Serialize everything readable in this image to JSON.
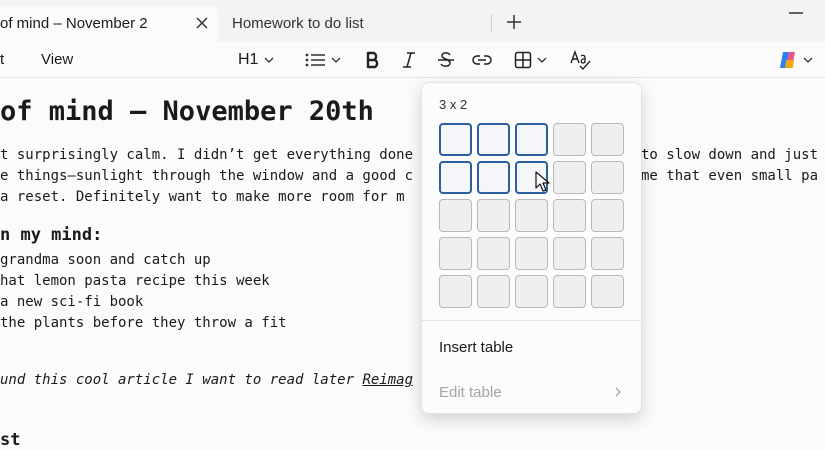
{
  "tabs": [
    {
      "title": "of mind – November 2",
      "active": true
    },
    {
      "title": "Homework to do list",
      "active": false
    }
  ],
  "menu": {
    "edit": "t",
    "view": "View"
  },
  "toolbar": {
    "heading": "H1"
  },
  "editor": {
    "title": "of mind – November 20th",
    "para1": "t surprisingly calm. I didn’t get everything done",
    "para1_tail": "to slow down and just",
    "para2": "e things—sunlight through the window and a good c",
    "para2_tail": "me that even small pa",
    "para3": "a reset. Definitely want to make more room for m",
    "section1": "n my mind:",
    "items": [
      "grandma soon and catch up",
      "hat lemon pasta recipe this week",
      "a new sci-fi book",
      " the plants before they throw a fit"
    ],
    "note": "und this cool article I want to read later ",
    "note_link": "Reimag",
    "section2": "st"
  },
  "table_popup": {
    "size_label": "3 x 2",
    "rows": 5,
    "cols": 5,
    "selected_cols": 3,
    "selected_rows": 2,
    "insert_label": "Insert table",
    "edit_label": "Edit table"
  },
  "colors": {
    "selection": "#2b5f9e",
    "copilot_blue": "#2f7cf6",
    "copilot_pink": "#e6457a",
    "copilot_yellow": "#f4b400"
  }
}
